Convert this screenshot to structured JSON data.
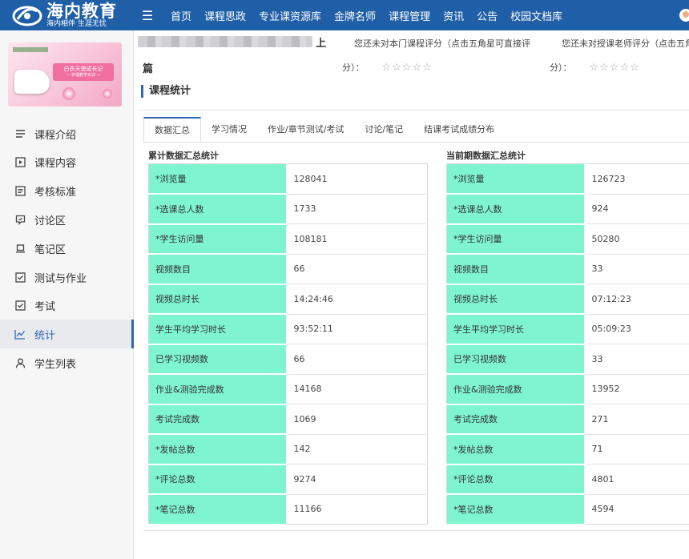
{
  "header": {
    "logo_title": "海内教育",
    "logo_subtitle": "海内相伴 生涯无忧",
    "nav": [
      "首页",
      "课程思政",
      "专业课资源库",
      "金牌名师",
      "课程管理",
      "资讯",
      "公告",
      "校园文档库"
    ]
  },
  "sidebar": {
    "banner_text": "白衣天使成长记",
    "banner_subtext": "— 护理教学实训 —",
    "items": [
      {
        "label": "课程介绍",
        "icon": "list-icon"
      },
      {
        "label": "课程内容",
        "icon": "play-box-icon"
      },
      {
        "label": "考核标准",
        "icon": "clipboard-icon"
      },
      {
        "label": "讨论区",
        "icon": "chat-icon"
      },
      {
        "label": "笔记区",
        "icon": "laptop-icon"
      },
      {
        "label": "测试与作业",
        "icon": "check-doc-icon"
      },
      {
        "label": "考试",
        "icon": "exam-icon"
      },
      {
        "label": "统计",
        "icon": "line-chart-icon"
      },
      {
        "label": "学生列表",
        "icon": "user-icon"
      }
    ],
    "active_index": 7
  },
  "course": {
    "name_tail": "上",
    "name_line2": "篇",
    "course_rate_hint": "您还未对本门课程评分（点击五角星可直接评",
    "course_rate_suffix": "分）：",
    "teacher_rate_hint": "您还未对授课老师评分（点击五角",
    "teacher_rate_suffix": "分）：",
    "stars": "☆☆☆☆☆"
  },
  "section_title": "课程统计",
  "tabs": [
    "数据汇总",
    "学习情况",
    "作业/章节测试/考试",
    "讨论/笔记",
    "结课考试成绩分布"
  ],
  "active_tab": 0,
  "cumulative": {
    "title": "累计数据汇总统计",
    "rows": [
      {
        "label": "*浏览量",
        "value": "128041"
      },
      {
        "label": "*选课总人数",
        "value": "1733"
      },
      {
        "label": "*学生访问量",
        "value": "108181"
      },
      {
        "label": "视频数目",
        "value": "66"
      },
      {
        "label": "视频总时长",
        "value": "14:24:46"
      },
      {
        "label": "学生平均学习时长",
        "value": "93:52:11"
      },
      {
        "label": "已学习视频数",
        "value": "66"
      },
      {
        "label": "作业&测验完成数",
        "value": "14168"
      },
      {
        "label": "考试完成数",
        "value": "1069"
      },
      {
        "label": "*发帖总数",
        "value": "142"
      },
      {
        "label": "*评论总数",
        "value": "9274"
      },
      {
        "label": "*笔记总数",
        "value": "11166"
      }
    ]
  },
  "current": {
    "title": "当前期数据汇总统计",
    "rows": [
      {
        "label": "*浏览量",
        "value": "126723"
      },
      {
        "label": "*选课总人数",
        "value": "924"
      },
      {
        "label": "*学生访问量",
        "value": "50280"
      },
      {
        "label": "视频数目",
        "value": "33"
      },
      {
        "label": "视频总时长",
        "value": "07:12:23"
      },
      {
        "label": "学生平均学习时长",
        "value": "05:09:23"
      },
      {
        "label": "已学习视频数",
        "value": "33"
      },
      {
        "label": "作业&测验完成数",
        "value": "13952"
      },
      {
        "label": "考试完成数",
        "value": "271"
      },
      {
        "label": "*发帖总数",
        "value": "71"
      },
      {
        "label": "*评论总数",
        "value": "4801"
      },
      {
        "label": "*笔记总数",
        "value": "4594"
      }
    ]
  },
  "colors": {
    "nav_bg": "#1f5fa8",
    "accent": "#2f66b5",
    "key_cell": "#7ff5cf"
  }
}
